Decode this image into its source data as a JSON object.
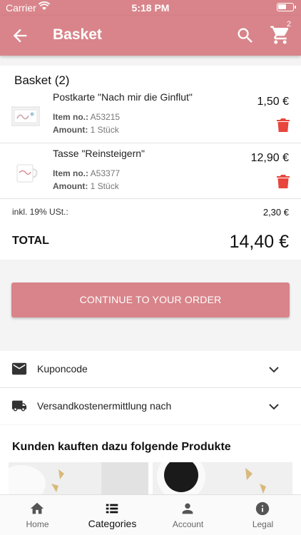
{
  "status": {
    "carrier": "Carrier",
    "time": "5:18 PM",
    "battery_level": 0.6
  },
  "appbar": {
    "title": "Basket",
    "cart_badge": "2",
    "icons": [
      "arrow-back-icon",
      "search-icon",
      "cart-icon"
    ]
  },
  "basket": {
    "title": "Basket (2)",
    "items": [
      {
        "name": "Postkarte \"Nach mir die Ginflut\"",
        "item_no_label": "Item no.:",
        "item_no": "A53215",
        "amount_label": "Amount:",
        "amount": "1 Stück",
        "price": "1,50 €"
      },
      {
        "name": "Tasse \"Reinsteigern\"",
        "item_no_label": "Item no.:",
        "item_no": "A53377",
        "amount_label": "Amount:",
        "amount": "1 Stück",
        "price": "12,90 €"
      }
    ],
    "tax_label": "inkl. 19% USt.:",
    "tax_value": "2,30 €",
    "total_label": "TOTAL",
    "total_value": "14,40 €"
  },
  "cta": {
    "label": "CONTINUE TO YOUR ORDER"
  },
  "accordions": [
    {
      "label": "Kuponcode",
      "icon": "mail-icon"
    },
    {
      "label": "Versandkostenermittlung nach",
      "icon": "truck-icon"
    }
  ],
  "recommendations": {
    "title": "Kunden kauften dazu folgende Produkte"
  },
  "tabs": [
    {
      "label": "Home",
      "icon": "home-icon",
      "active": false
    },
    {
      "label": "Categories",
      "icon": "list-icon",
      "active": true
    },
    {
      "label": "Account",
      "icon": "person-icon",
      "active": false
    },
    {
      "label": "Legal",
      "icon": "info-icon",
      "active": false
    }
  ],
  "colors": {
    "brand": "#d8848a",
    "delete": "#e8453c"
  }
}
